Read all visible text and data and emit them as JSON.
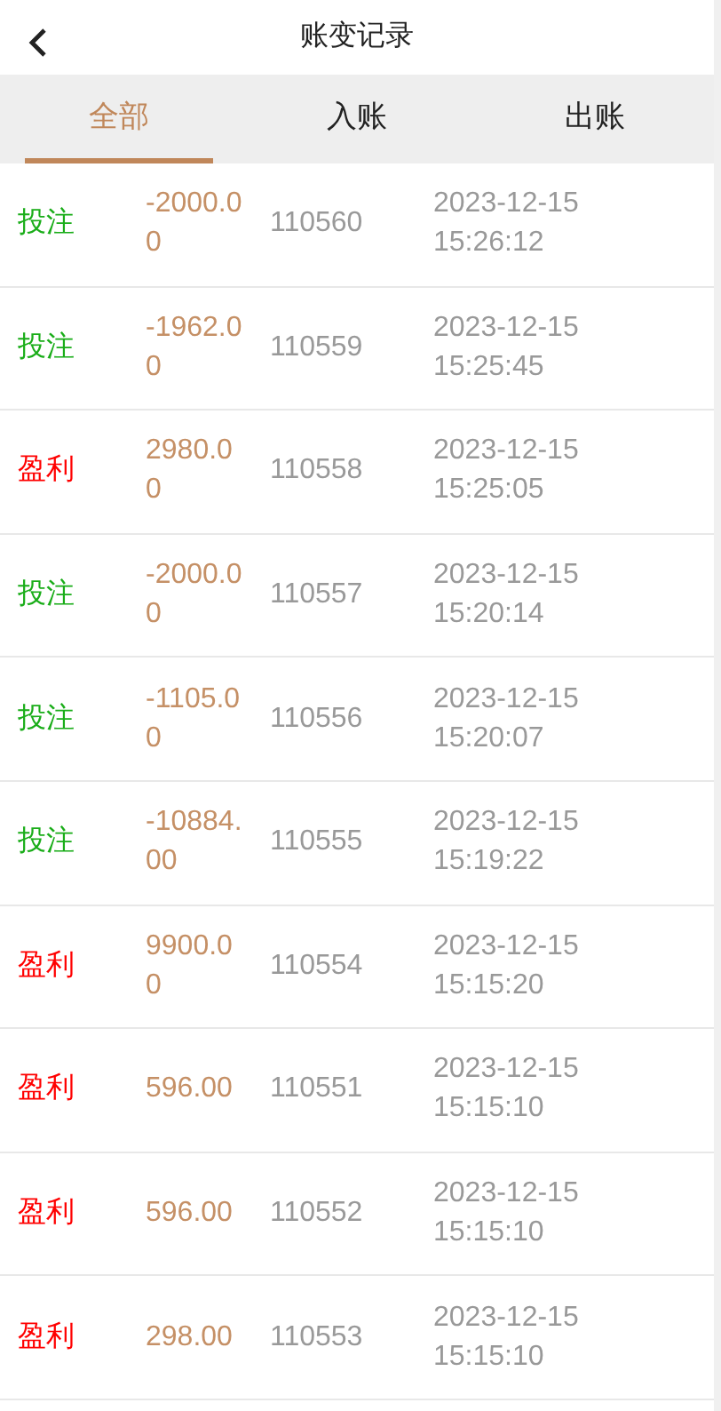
{
  "header": {
    "title": "账变记录"
  },
  "tabs": [
    {
      "label": "全部",
      "selected": true
    },
    {
      "label": "入账",
      "selected": false
    },
    {
      "label": "出账",
      "selected": false
    }
  ],
  "records": [
    {
      "kind": "bet",
      "type": "投注",
      "amount": "-2000.00",
      "id": "110560",
      "date": "2023-12-15",
      "time": "15:26:12"
    },
    {
      "kind": "bet",
      "type": "投注",
      "amount": "-1962.00",
      "id": "110559",
      "date": "2023-12-15",
      "time": "15:25:45"
    },
    {
      "kind": "profit",
      "type": "盈利",
      "amount": "2980.00",
      "id": "110558",
      "date": "2023-12-15",
      "time": "15:25:05"
    },
    {
      "kind": "bet",
      "type": "投注",
      "amount": "-2000.00",
      "id": "110557",
      "date": "2023-12-15",
      "time": "15:20:14"
    },
    {
      "kind": "bet",
      "type": "投注",
      "amount": "-1105.00",
      "id": "110556",
      "date": "2023-12-15",
      "time": "15:20:07"
    },
    {
      "kind": "bet",
      "type": "投注",
      "amount": "-10884.00",
      "id": "110555",
      "date": "2023-12-15",
      "time": "15:19:22"
    },
    {
      "kind": "profit",
      "type": "盈利",
      "amount": "9900.00",
      "id": "110554",
      "date": "2023-12-15",
      "time": "15:15:20"
    },
    {
      "kind": "profit",
      "type": "盈利",
      "amount": "596.00",
      "id": "110551",
      "date": "2023-12-15",
      "time": "15:15:10"
    },
    {
      "kind": "profit",
      "type": "盈利",
      "amount": "596.00",
      "id": "110552",
      "date": "2023-12-15",
      "time": "15:15:10"
    },
    {
      "kind": "profit",
      "type": "盈利",
      "amount": "298.00",
      "id": "110553",
      "date": "2023-12-15",
      "time": "15:15:10"
    }
  ]
}
